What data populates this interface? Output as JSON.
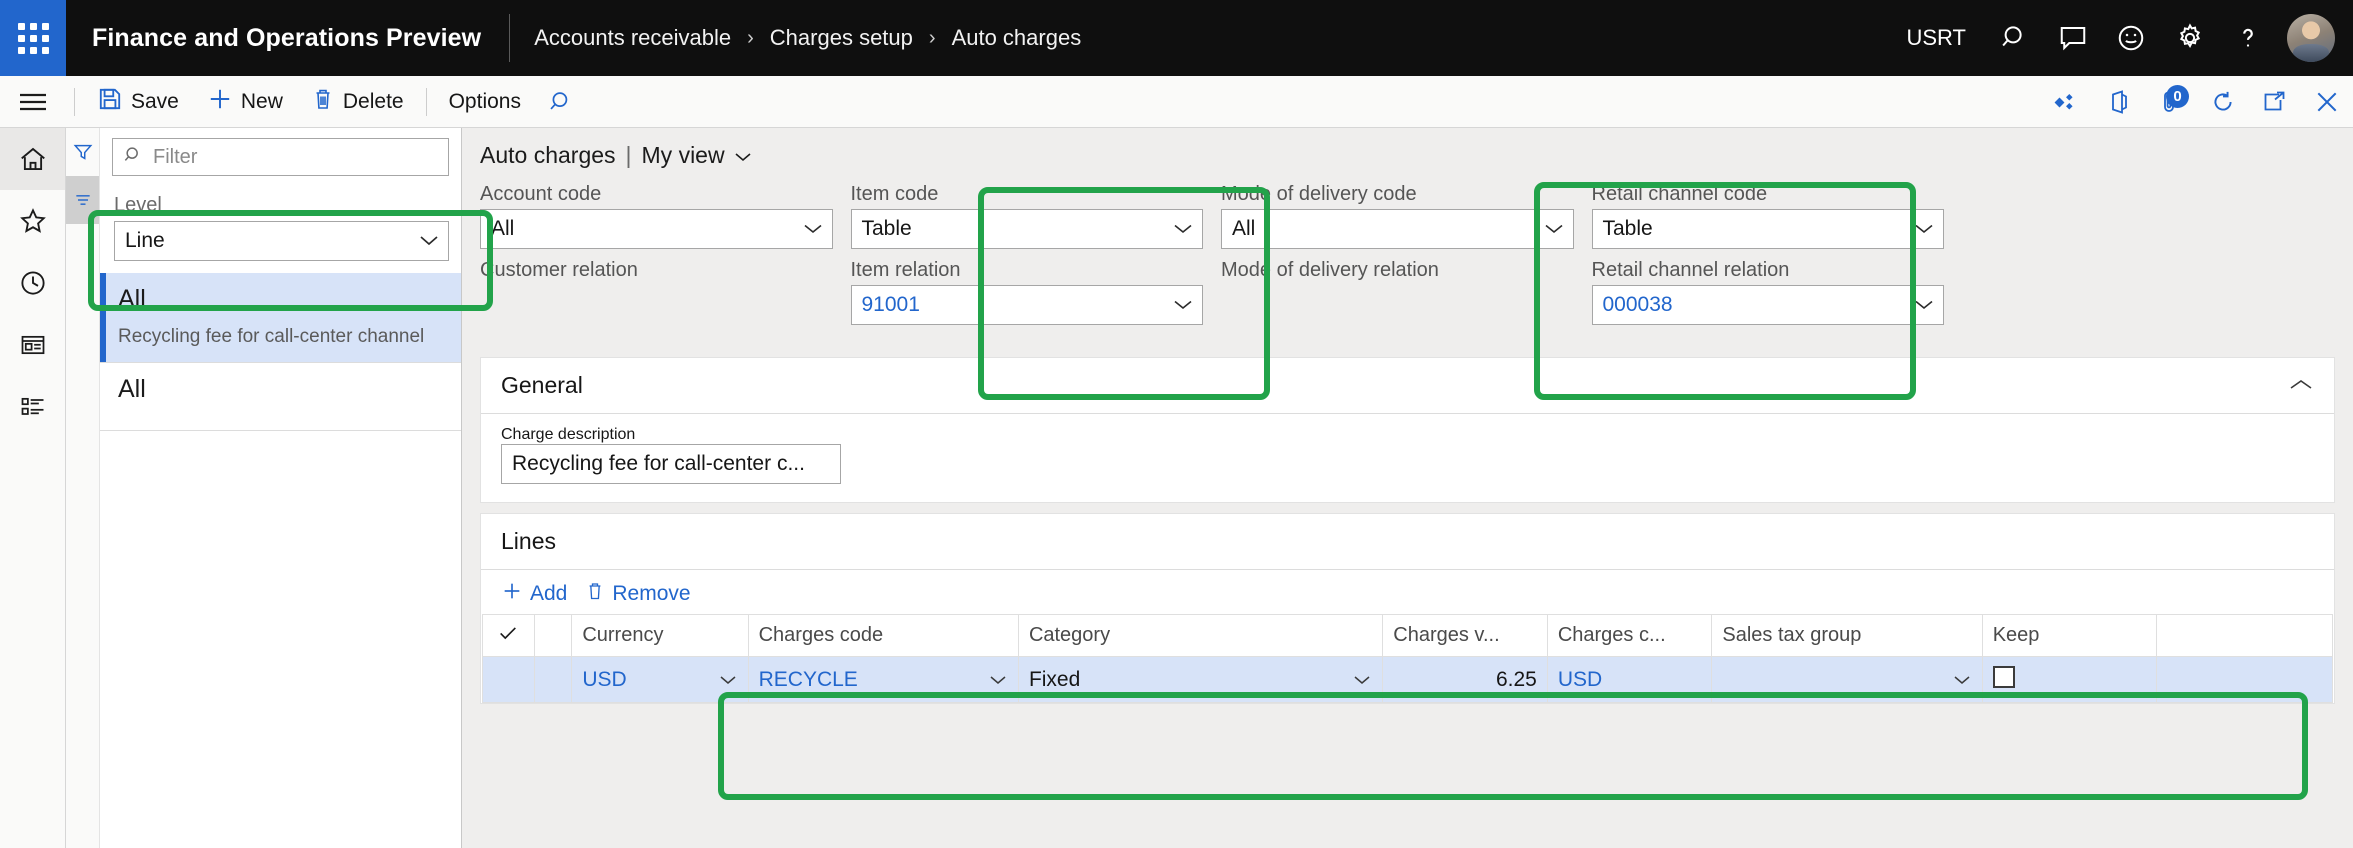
{
  "header": {
    "app_title": "Finance and Operations Preview",
    "breadcrumb": [
      "Accounts receivable",
      "Charges setup",
      "Auto charges"
    ],
    "breadcrumb_separator": "›",
    "company": "USRT",
    "icons": [
      "search-icon",
      "feedback-icon",
      "smiley-icon",
      "gear-icon",
      "help-icon",
      "avatar"
    ]
  },
  "commandbar": {
    "menu_icon": "hamburger-icon",
    "save_label": "Save",
    "new_label": "New",
    "delete_label": "Delete",
    "options_label": "Options",
    "search_icon": "search-icon",
    "right_icons": [
      "relate-icon",
      "office-apps-icon",
      "attachments-icon",
      "refresh-icon",
      "popout-icon",
      "close-icon"
    ],
    "attachment_count": "0"
  },
  "rail": {
    "items": [
      "home-icon",
      "favorites-star-icon",
      "recent-clock-icon",
      "workspaces-icon",
      "modules-list-icon"
    ]
  },
  "listpane": {
    "filter_placeholder": "Filter",
    "filter_value": "",
    "filter_icon": "filter-icon",
    "sort_icon": "sort-icon",
    "level_label": "Level",
    "level_value": "Line",
    "items": [
      {
        "title": "All",
        "subtitle": "Recycling fee for call-center channel",
        "selected": true
      },
      {
        "title": "All",
        "subtitle": "",
        "selected": false
      }
    ]
  },
  "form": {
    "title": "Auto charges",
    "separator": "|",
    "view_name": "My view",
    "fields": [
      {
        "label": "Account code",
        "value": "All",
        "type": "select",
        "link": false
      },
      {
        "label": "Item code",
        "value": "Table",
        "type": "select",
        "link": false
      },
      {
        "label": "Mode of delivery code",
        "value": "All",
        "type": "select",
        "link": false
      },
      {
        "label": "Retail channel code",
        "value": "Table",
        "type": "select",
        "link": false
      },
      {
        "label": "Customer relation",
        "value": "",
        "type": "blank",
        "link": false
      },
      {
        "label": "Item relation",
        "value": "91001",
        "type": "select",
        "link": true
      },
      {
        "label": "Mode of delivery relation",
        "value": "",
        "type": "blank",
        "link": false
      },
      {
        "label": "Retail channel relation",
        "value": "000038",
        "type": "select",
        "link": true
      }
    ]
  },
  "general": {
    "section_title": "General",
    "collapse_icon": "chevron-up-icon",
    "charge_description_label": "Charge description",
    "charge_description_value": "Recycling fee for call-center c..."
  },
  "lines": {
    "section_title": "Lines",
    "add_label": "Add",
    "remove_label": "Remove",
    "columns": [
      "Currency",
      "Charges code",
      "Category",
      "Charges v...",
      "Charges c...",
      "Sales tax group",
      "Keep"
    ],
    "rows": [
      {
        "currency": "USD",
        "charges_code": "RECYCLE",
        "category": "Fixed",
        "charges_value": "6.25",
        "charges_currency": "USD",
        "sales_tax_group": "",
        "keep": false
      }
    ]
  },
  "colors": {
    "accent": "#2266cc",
    "annotation": "#22a34a",
    "row_selected": "#d7e3f8",
    "header_bg": "#0f0f0f"
  }
}
